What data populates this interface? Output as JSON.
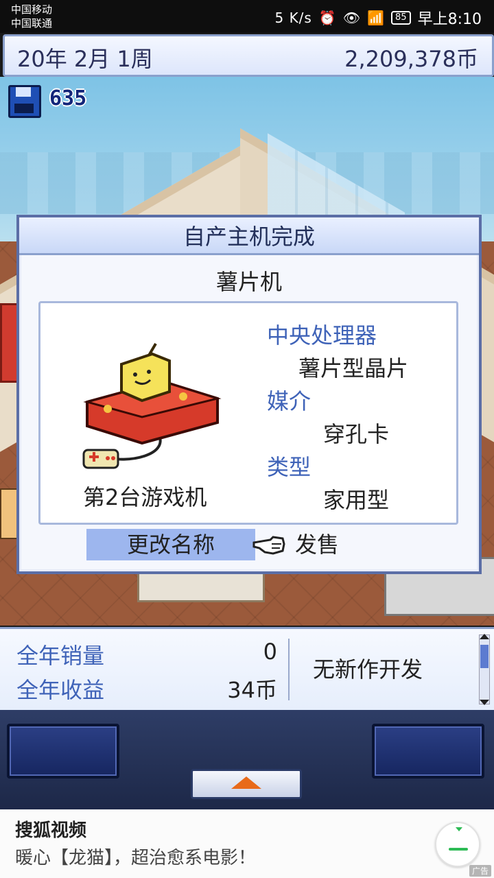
{
  "status_bar": {
    "carrier1": "中国移动",
    "carrier2": "中国联通",
    "speed": "5 K/s",
    "battery": "85",
    "time": "早上8:10"
  },
  "top_bar": {
    "date": "20年 2月 1周",
    "money": "2,209,378币"
  },
  "save": {
    "count": "635"
  },
  "dialog": {
    "title": "自产主机完成",
    "console_name": "薯片机",
    "console_label": "第2台游戏机",
    "specs": {
      "cpu_label": "中央处理器",
      "cpu_value": "薯片型晶片",
      "media_label": "媒介",
      "media_value": "穿孔卡",
      "type_label": "类型",
      "type_value": "家用型"
    },
    "rename_button": "更改名称",
    "sell_button": "发售"
  },
  "info_panel": {
    "annual_sales_label": "全年销量",
    "annual_sales_value": "0",
    "annual_revenue_label": "全年收益",
    "annual_revenue_value": "34币",
    "news": "无新作开发"
  },
  "ad": {
    "title": "搜狐视频",
    "text": "暖心【龙猫】，超治愈系电影！",
    "tag": "广告"
  },
  "colors": {
    "accent_blue": "#3f63b8",
    "rename_highlight": "#9db6ee",
    "dialog_border": "#5b6ea6"
  }
}
